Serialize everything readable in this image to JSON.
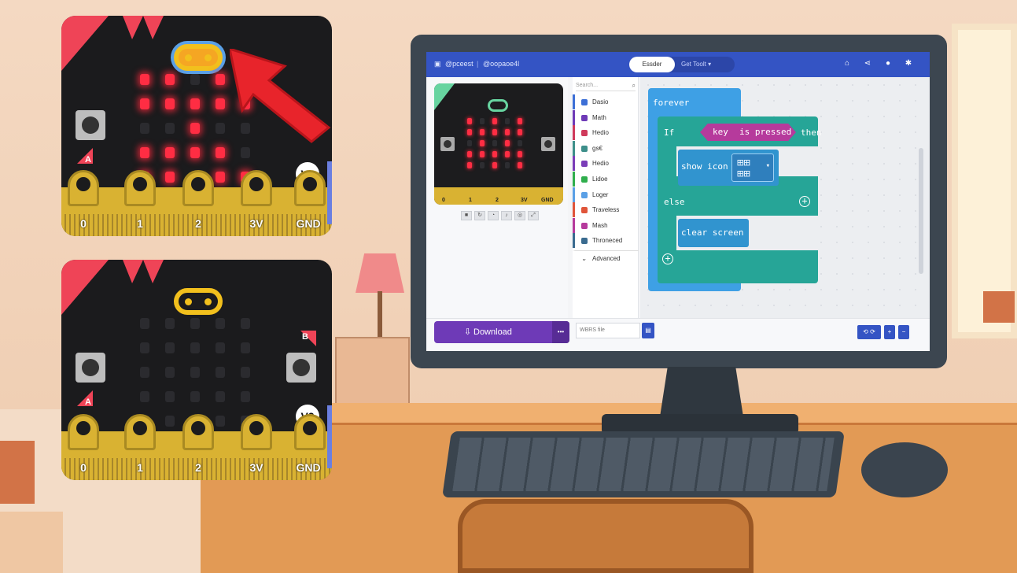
{
  "board_top": {
    "button_a_label": "A",
    "badge": "V2",
    "pins": [
      "0",
      "1",
      "2",
      "3V",
      "GND"
    ],
    "leds_on": [
      [
        1,
        1,
        0,
        1,
        0
      ],
      [
        1,
        1,
        1,
        1,
        1
      ],
      [
        0,
        0,
        1,
        0,
        0
      ],
      [
        1,
        1,
        1,
        1,
        0
      ],
      [
        1,
        1,
        0,
        1,
        1
      ]
    ]
  },
  "board_bottom": {
    "button_a_label": "A",
    "button_b_label": "B",
    "badge": "V2",
    "pins": [
      "0",
      "1",
      "2",
      "3V",
      "GND"
    ]
  },
  "editor": {
    "topbar": {
      "project_left": "@pceest",
      "project_right": "@oopaoe4l",
      "tab_active": "Essder",
      "tab_other": "Get Toolt"
    },
    "toolbox": {
      "search_placeholder": "Search...",
      "items": [
        {
          "label": "Dasio",
          "color": "#3c6fd6"
        },
        {
          "label": "Math",
          "color": "#6e3ab7"
        },
        {
          "label": "Hedio",
          "color": "#cf3a5b"
        },
        {
          "label": "gs€",
          "color": "#3d8f8a"
        },
        {
          "label": "Hedio",
          "color": "#7a3db8"
        },
        {
          "label": "Lidoe",
          "color": "#2fae4d"
        },
        {
          "label": "Loger",
          "color": "#5aa0e6"
        },
        {
          "label": "Traveless",
          "color": "#e0553a"
        },
        {
          "label": "Mash",
          "color": "#b63a9c"
        },
        {
          "label": "Throneced",
          "color": "#3a6b8f"
        }
      ],
      "advanced": "Advanced"
    },
    "blocks": {
      "forever": "forever",
      "if": "If",
      "key": "key",
      "is_pressed": "is pressed",
      "then": "then",
      "show_icon": "show icon",
      "else": "else",
      "clear_screen": "clear screen"
    },
    "simulator": {
      "pins": [
        "0",
        "1",
        "2",
        "3V",
        "GND"
      ],
      "leds_on": [
        [
          1,
          0,
          1,
          0,
          1
        ],
        [
          1,
          1,
          1,
          1,
          1
        ],
        [
          0,
          1,
          0,
          1,
          0
        ],
        [
          1,
          1,
          1,
          1,
          1
        ],
        [
          1,
          0,
          1,
          0,
          1
        ]
      ]
    },
    "bottombar": {
      "download": "Download",
      "project_name": "WBRS file"
    }
  },
  "icons": {
    "arrow_color": "#e8242b",
    "accent": "#3454c4"
  }
}
